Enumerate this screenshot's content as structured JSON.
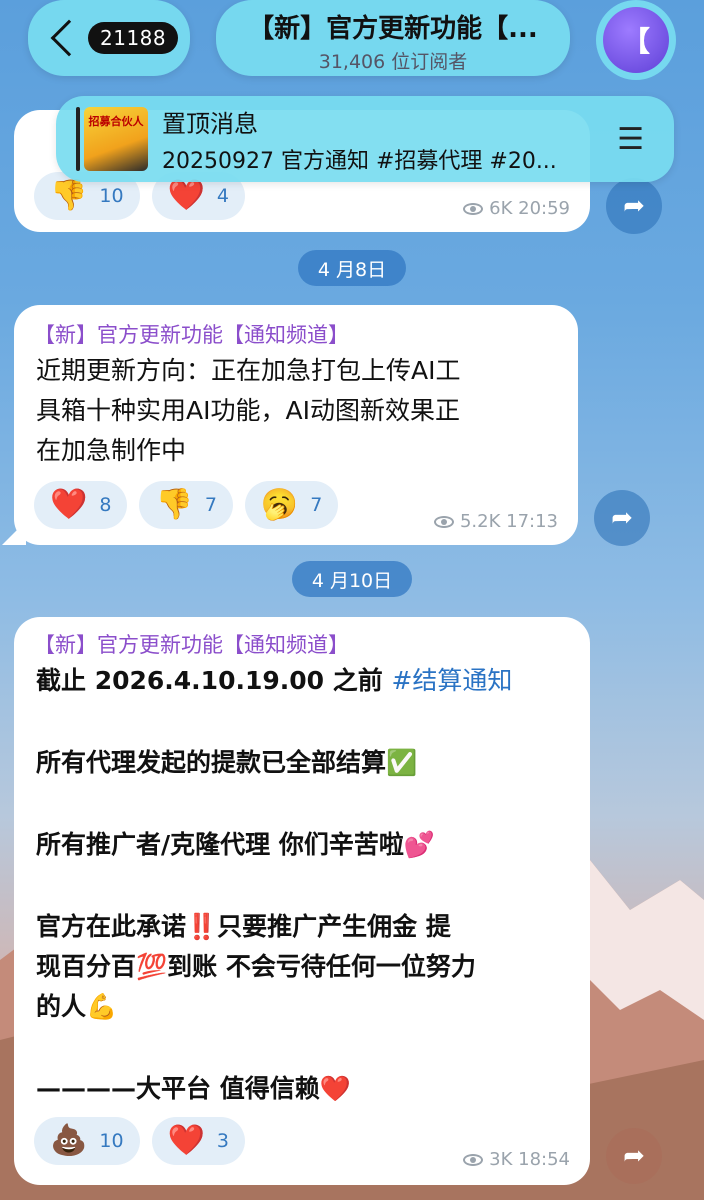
{
  "header": {
    "unread_count": "21188",
    "channel_title": "【新】官方更新功能【...",
    "subscribers": "31,406 位订阅者",
    "avatar_letter": "【"
  },
  "pinned": {
    "label": "置顶消息",
    "text": "20250927 官方通知 #招募代理 #20...",
    "thumb_text": "招募合伙人"
  },
  "messages": [
    {
      "reactions": [
        {
          "emoji": "👎",
          "count": "10"
        },
        {
          "emoji": "❤️",
          "count": "4"
        }
      ],
      "views": "6K",
      "time": "20:59"
    },
    {
      "date": "4 月8日",
      "sender": "【新】官方更新功能【通知频道】",
      "lines": [
        "近期更新方向：正在加急打包上传AI工",
        "具箱十种实用AI功能，AI动图新效果正",
        "在加急制作中"
      ],
      "reactions": [
        {
          "emoji": "❤️",
          "count": "8"
        },
        {
          "emoji": "👎",
          "count": "7"
        },
        {
          "emoji": "🥱",
          "count": "7"
        }
      ],
      "views": "5.2K",
      "time": "17:13"
    },
    {
      "date": "4 月10日",
      "sender": "【新】官方更新功能【通知频道】",
      "line1_text": "截止 2026.4.10.19.00 之前 ",
      "line1_hashtag": "#结算通知",
      "line2": "所有代理发起的提款已全部结算✅",
      "line3": "所有推广者/克隆代理 你们辛苦啦💕",
      "line4": "官方在此承诺‼️只要推广产生佣金 提",
      "line5": "现百分百💯到账 不会亏待任何一位努力",
      "line6": "的人💪",
      "line7": "————大平台 值得信赖❤️",
      "reactions": [
        {
          "emoji": "💩",
          "count": "10"
        },
        {
          "emoji": "❤️",
          "count": "3"
        }
      ],
      "views": "3K",
      "time": "18:54"
    }
  ],
  "icons": {
    "share": "➦",
    "pin": "📌"
  }
}
